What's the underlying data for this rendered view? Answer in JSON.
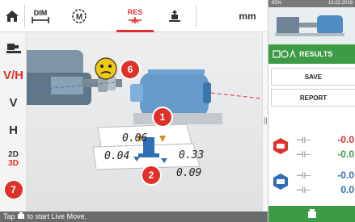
{
  "toolbar": {
    "home_icon": "home-icon",
    "dim_label": "DIM",
    "machine_label": "M",
    "res_label": "RES",
    "unit": "mm"
  },
  "sidebar": {
    "items": [
      {
        "name": "machine-train"
      },
      {
        "label": "V/H"
      },
      {
        "label": "V"
      },
      {
        "label": "H"
      },
      {
        "label_top": "2D",
        "label_bottom": "3D"
      },
      {
        "label": "7"
      }
    ]
  },
  "viewport": {
    "markers": [
      "1",
      "2",
      "6"
    ],
    "values": {
      "top_left": "0.06",
      "top_right": "0.33",
      "bottom_left": "0.04",
      "bottom_right": "0.09"
    },
    "status_face": "neutral"
  },
  "status_bar": {
    "prefix": "Tap",
    "suffix": "to start Live Move."
  },
  "right_panel": {
    "battery": "85%",
    "date": "13.02.2019",
    "results_label": "RESULTS",
    "save_label": "SAVE",
    "report_label": "REPORT",
    "values": [
      "-0.0",
      "-0.0",
      "-0.0",
      "0.0"
    ],
    "colors": {
      "green": "#3d9b45",
      "red": "#e0302a",
      "blue": "#2f6fb6"
    }
  }
}
